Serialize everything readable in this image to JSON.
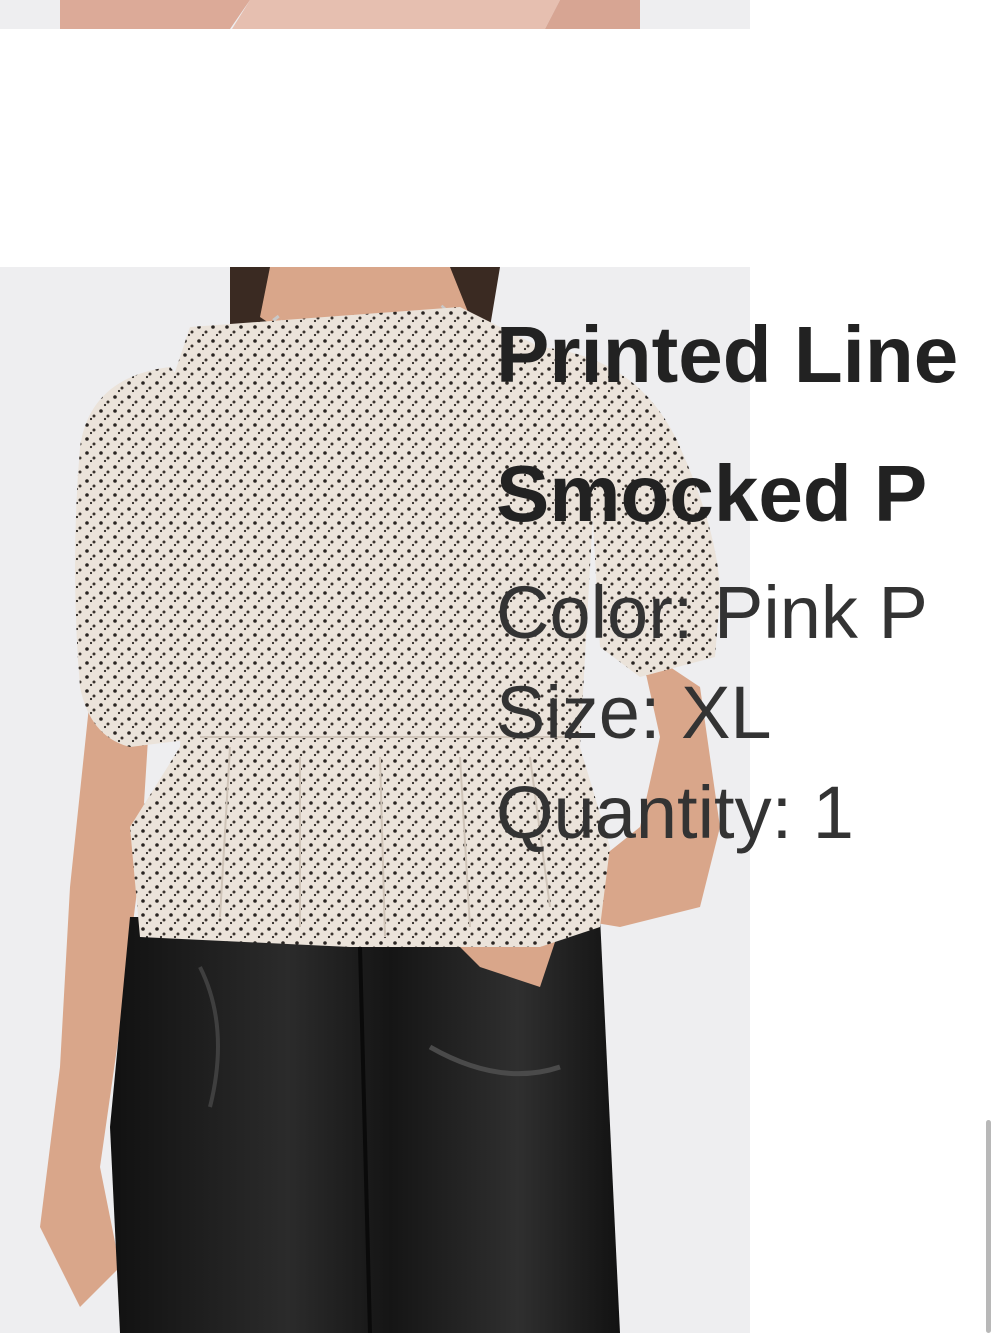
{
  "product": {
    "title_line1": "Printed Line",
    "title_line2": "Smocked P",
    "color_label": "Color:",
    "color_value": "Pink P",
    "size_label": "Size:",
    "size_value": "XL",
    "quantity_label": "Quantity:",
    "quantity_value": "1"
  },
  "images": {
    "previous_item": "model-wearing-pink-satin-top-photo",
    "main": "model-wearing-printed-smocked-peplum-top-photo"
  },
  "colors": {
    "photo_background": "#eeeef0",
    "title_text": "#222222",
    "attribute_text": "#333333",
    "top_fabric": "#e8e0d8",
    "prev_top_fabric": "#e2b8a8",
    "pants": "#1c1c1c",
    "skin": "#d9a68a",
    "hair": "#3a2a22"
  }
}
